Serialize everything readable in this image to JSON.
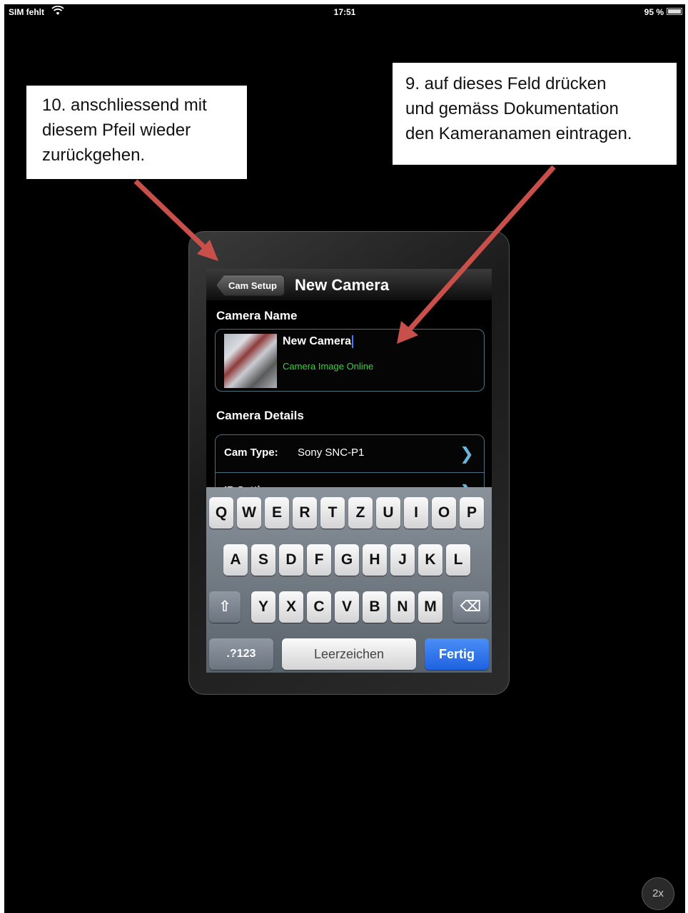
{
  "status_bar": {
    "carrier": "SIM fehlt",
    "time": "17:51",
    "battery": "95 %"
  },
  "callouts": {
    "back": [
      "10. anschliessend mit",
      "diesem Pfeil wieder",
      "zurückgehen."
    ],
    "name": [
      "9. auf dieses Feld drücken",
      "und gemäss Dokumentation",
      "den Kameranamen eintragen."
    ]
  },
  "nav": {
    "back_label": "Cam Setup",
    "title": "New Camera"
  },
  "camera_name_section": {
    "label": "Camera Name",
    "value": "New Camera",
    "status": "Camera Image Online"
  },
  "camera_details_section": {
    "label": "Camera Details",
    "rows": [
      {
        "key": "Cam Type:",
        "value": "Sony SNC-P1"
      },
      {
        "key": "IP Settings:",
        "value": ""
      }
    ]
  },
  "keyboard": {
    "row1": [
      "Q",
      "W",
      "E",
      "R",
      "T",
      "Z",
      "U",
      "I",
      "O",
      "P"
    ],
    "row2": [
      "A",
      "S",
      "D",
      "F",
      "G",
      "H",
      "J",
      "K",
      "L"
    ],
    "row3": [
      "Y",
      "X",
      "C",
      "V",
      "B",
      "N",
      "M"
    ],
    "numbers": ".?123",
    "space": "Leerzeichen",
    "done": "Fertig",
    "shift_icon": "⇧",
    "delete_icon": "⌫"
  },
  "zoom_label": "2x",
  "colors": {
    "arrow": "#c9504a",
    "done_key": "#2a6fe8",
    "status_online": "#3bd23b"
  }
}
